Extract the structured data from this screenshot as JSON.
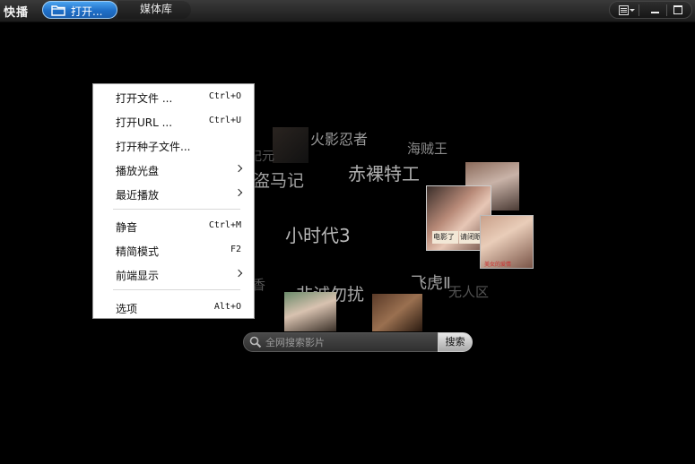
{
  "titlebar": {
    "app_name": "快播",
    "open_button_label": "打开...",
    "media_library_label": "媒体库"
  },
  "cloud": {
    "tags": [
      {
        "text": "火影忍者",
        "color": "#9a9a9a"
      },
      {
        "text": "海贼王",
        "color": "#8a8a8a"
      },
      {
        "text": "赤裸特工",
        "color": "#b0b0b0"
      },
      {
        "text": "盗马记",
        "color": "#a0a0a0"
      },
      {
        "text": "小时代3",
        "color": "#b8b8b8"
      },
      {
        "text": "非诚勿扰",
        "color": "#a8a8a8"
      },
      {
        "text": "飞虎Ⅱ",
        "color": "#a0a0a0"
      },
      {
        "text": "无人区",
        "color": "#555555"
      },
      {
        "text": "纪元",
        "color": "#555555"
      },
      {
        "text": "香",
        "color": "#555555"
      }
    ],
    "thumb_captions": {
      "kiss_left": "电影了",
      "kiss_right": "请闭眼",
      "portrait_caption": "美女的爱情"
    }
  },
  "search": {
    "placeholder": "全网搜索影片",
    "button_label": "搜索"
  },
  "menu": {
    "items": [
      {
        "label": "打开文件 ...",
        "shortcut": "Ctrl+O"
      },
      {
        "label": "打开URL ...",
        "shortcut": "Ctrl+U"
      },
      {
        "label": "打开种子文件...",
        "shortcut": ""
      },
      {
        "label": "播放光盘",
        "shortcut": ""
      },
      {
        "label": "最近播放",
        "shortcut": ""
      },
      {
        "label": "静音",
        "shortcut": "Ctrl+M"
      },
      {
        "label": "精简模式",
        "shortcut": "F2"
      },
      {
        "label": "前端显示",
        "shortcut": ""
      },
      {
        "label": "选项",
        "shortcut": "Alt+O"
      }
    ]
  }
}
